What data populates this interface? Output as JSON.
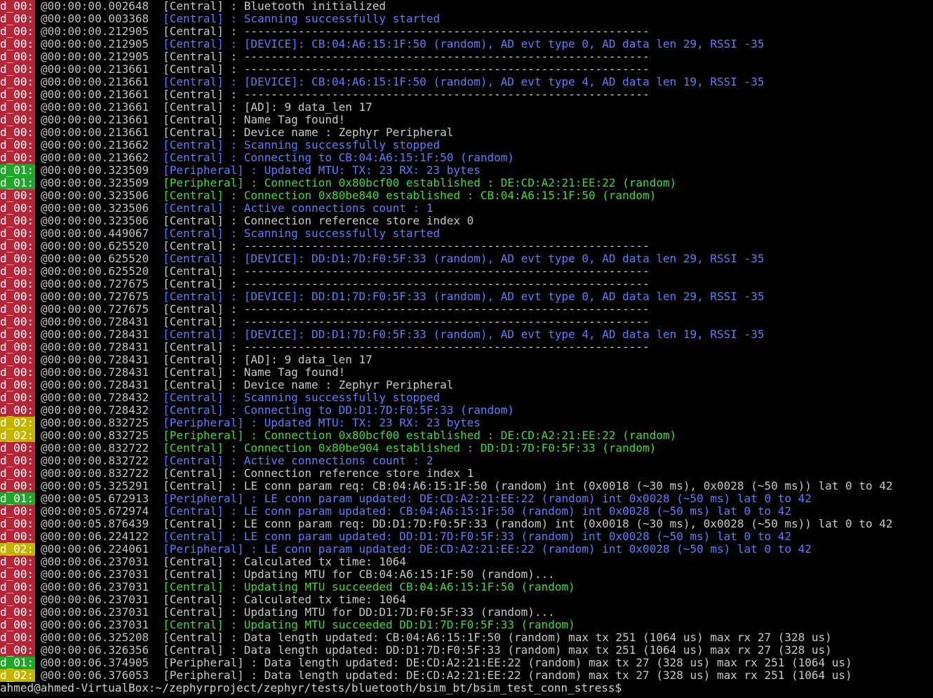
{
  "prompt": "ahmed@ahmed-VirtualBox:~/zephyrproject/zephyr/tests/bluetooth/bsim_bt/bsim_test_conn_stress$",
  "colors": {
    "d_00": "#b3263a",
    "d_01": "#22a52b",
    "d_02": "#c3b400",
    "white": "#c8c8c8",
    "blue": "#5c7cff",
    "green": "#3adb3a"
  },
  "lines": [
    {
      "tag": "d_00:",
      "time": "@00:00:00.002648",
      "role": "[Central]",
      "msg": " : Bluetooth initialized",
      "c": "w"
    },
    {
      "tag": "d_00:",
      "time": "@00:00:00.003368",
      "role": "[Central]",
      "msg": " : Scanning successfully started",
      "c": "b"
    },
    {
      "tag": "d_00:",
      "time": "@00:00:00.212905",
      "role": "[Central]",
      "msg": " : ------------------------------------------------------------",
      "c": "w"
    },
    {
      "tag": "d_00:",
      "time": "@00:00:00.212905",
      "role": "[Central]",
      "msg": " : [DEVICE]: CB:04:A6:15:1F:50 (random), AD evt type 0, AD data len 29, RSSI -35",
      "c": "b"
    },
    {
      "tag": "d_00:",
      "time": "@00:00:00.212905",
      "role": "[Central]",
      "msg": " : ------------------------------------------------------------",
      "c": "w"
    },
    {
      "tag": "d_00:",
      "time": "@00:00:00.213661",
      "role": "[Central]",
      "msg": " : ------------------------------------------------------------",
      "c": "w"
    },
    {
      "tag": "d_00:",
      "time": "@00:00:00.213661",
      "role": "[Central]",
      "msg": " : [DEVICE]: CB:04:A6:15:1F:50 (random), AD evt type 4, AD data len 19, RSSI -35",
      "c": "b"
    },
    {
      "tag": "d_00:",
      "time": "@00:00:00.213661",
      "role": "[Central]",
      "msg": " : ------------------------------------------------------------",
      "c": "w"
    },
    {
      "tag": "d_00:",
      "time": "@00:00:00.213661",
      "role": "[Central]",
      "msg": " : [AD]: 9 data_len 17",
      "c": "w"
    },
    {
      "tag": "d_00:",
      "time": "@00:00:00.213661",
      "role": "[Central]",
      "msg": " : Name Tag found!",
      "c": "w"
    },
    {
      "tag": "d_00:",
      "time": "@00:00:00.213661",
      "role": "[Central]",
      "msg": " : Device name : Zephyr Peripheral",
      "c": "w"
    },
    {
      "tag": "d_00:",
      "time": "@00:00:00.213662",
      "role": "[Central]",
      "msg": " : Scanning successfully stopped",
      "c": "b"
    },
    {
      "tag": "d_00:",
      "time": "@00:00:00.213662",
      "role": "[Central]",
      "msg": " : Connecting to CB:04:A6:15:1F:50 (random)",
      "c": "b"
    },
    {
      "tag": "d_01:",
      "time": "@00:00:00.323509",
      "role": "[Peripheral]",
      "msg": " : Updated MTU: TX: 23 RX: 23 bytes",
      "c": "b"
    },
    {
      "tag": "d_01:",
      "time": "@00:00:00.323509",
      "role": "[Peripheral]",
      "msg": " : Connection 0x80bcf00 established : DE:CD:A2:21:EE:22 (random)",
      "c": "g"
    },
    {
      "tag": "d_00:",
      "time": "@00:00:00.323506",
      "role": "[Central]",
      "msg": " : Connection 0x80be840 established : CB:04:A6:15:1F:50 (random)",
      "c": "g"
    },
    {
      "tag": "d_00:",
      "time": "@00:00:00.323506",
      "role": "[Central]",
      "msg": " : Active connections count : 1",
      "c": "b"
    },
    {
      "tag": "d_00:",
      "time": "@00:00:00.323506",
      "role": "[Central]",
      "msg": " : Connection reference store index 0",
      "c": "w"
    },
    {
      "tag": "d_00:",
      "time": "@00:00:00.449067",
      "role": "[Central]",
      "msg": " : Scanning successfully started",
      "c": "b"
    },
    {
      "tag": "d_00:",
      "time": "@00:00:00.625520",
      "role": "[Central]",
      "msg": " : ------------------------------------------------------------",
      "c": "w"
    },
    {
      "tag": "d_00:",
      "time": "@00:00:00.625520",
      "role": "[Central]",
      "msg": " : [DEVICE]: DD:D1:7D:F0:5F:33 (random), AD evt type 0, AD data len 29, RSSI -35",
      "c": "b"
    },
    {
      "tag": "d_00:",
      "time": "@00:00:00.625520",
      "role": "[Central]",
      "msg": " : ------------------------------------------------------------",
      "c": "w"
    },
    {
      "tag": "d_00:",
      "time": "@00:00:00.727675",
      "role": "[Central]",
      "msg": " : ------------------------------------------------------------",
      "c": "w"
    },
    {
      "tag": "d_00:",
      "time": "@00:00:00.727675",
      "role": "[Central]",
      "msg": " : [DEVICE]: DD:D1:7D:F0:5F:33 (random), AD evt type 0, AD data len 29, RSSI -35",
      "c": "b"
    },
    {
      "tag": "d_00:",
      "time": "@00:00:00.727675",
      "role": "[Central]",
      "msg": " : ------------------------------------------------------------",
      "c": "w"
    },
    {
      "tag": "d_00:",
      "time": "@00:00:00.728431",
      "role": "[Central]",
      "msg": " : ------------------------------------------------------------",
      "c": "w"
    },
    {
      "tag": "d_00:",
      "time": "@00:00:00.728431",
      "role": "[Central]",
      "msg": " : [DEVICE]: DD:D1:7D:F0:5F:33 (random), AD evt type 4, AD data len 19, RSSI -35",
      "c": "b"
    },
    {
      "tag": "d_00:",
      "time": "@00:00:00.728431",
      "role": "[Central]",
      "msg": " : ------------------------------------------------------------",
      "c": "w"
    },
    {
      "tag": "d_00:",
      "time": "@00:00:00.728431",
      "role": "[Central]",
      "msg": " : [AD]: 9 data_len 17",
      "c": "w"
    },
    {
      "tag": "d_00:",
      "time": "@00:00:00.728431",
      "role": "[Central]",
      "msg": " : Name Tag found!",
      "c": "w"
    },
    {
      "tag": "d_00:",
      "time": "@00:00:00.728431",
      "role": "[Central]",
      "msg": " : Device name : Zephyr Peripheral",
      "c": "w"
    },
    {
      "tag": "d_00:",
      "time": "@00:00:00.728432",
      "role": "[Central]",
      "msg": " : Scanning successfully stopped",
      "c": "b"
    },
    {
      "tag": "d_00:",
      "time": "@00:00:00.728432",
      "role": "[Central]",
      "msg": " : Connecting to DD:D1:7D:F0:5F:33 (random)",
      "c": "b"
    },
    {
      "tag": "d_02:",
      "time": "@00:00:00.832725",
      "role": "[Peripheral]",
      "msg": " : Updated MTU: TX: 23 RX: 23 bytes",
      "c": "b"
    },
    {
      "tag": "d_02:",
      "time": "@00:00:00.832725",
      "role": "[Peripheral]",
      "msg": " : Connection 0x80bcf00 established : DE:CD:A2:21:EE:22 (random)",
      "c": "g"
    },
    {
      "tag": "d_00:",
      "time": "@00:00:00.832722",
      "role": "[Central]",
      "msg": " : Connection 0x80be904 established : DD:D1:7D:F0:5F:33 (random)",
      "c": "g"
    },
    {
      "tag": "d_00:",
      "time": "@00:00:00.832722",
      "role": "[Central]",
      "msg": " : Active connections count : 2",
      "c": "b"
    },
    {
      "tag": "d_00:",
      "time": "@00:00:00.832722",
      "role": "[Central]",
      "msg": " : Connection reference store index 1",
      "c": "w"
    },
    {
      "tag": "d_00:",
      "time": "@00:00:05.325291",
      "role": "[Central]",
      "msg": " : LE conn param req: CB:04:A6:15:1F:50 (random) int (0x0018 (~30 ms), 0x0028 (~50 ms)) lat 0 to 42",
      "c": "w"
    },
    {
      "tag": "d_01:",
      "time": "@00:00:05.672913",
      "role": "[Peripheral]",
      "msg": " : LE conn param updated: DE:CD:A2:21:EE:22 (random) int 0x0028 (~50 ms) lat 0 to 42",
      "c": "b"
    },
    {
      "tag": "d_00:",
      "time": "@00:00:05.672974",
      "role": "[Central]",
      "msg": " : LE conn param updated: CB:04:A6:15:1F:50 (random) int 0x0028 (~50 ms) lat 0 to 42",
      "c": "b"
    },
    {
      "tag": "d_00:",
      "time": "@00:00:05.876439",
      "role": "[Central]",
      "msg": " : LE conn param req: DD:D1:7D:F0:5F:33 (random) int (0x0018 (~30 ms), 0x0028 (~50 ms)) lat 0 to 42",
      "c": "w"
    },
    {
      "tag": "d_00:",
      "time": "@00:00:06.224122",
      "role": "[Central]",
      "msg": " : LE conn param updated: DD:D1:7D:F0:5F:33 (random) int 0x0028 (~50 ms) lat 0 to 42",
      "c": "b"
    },
    {
      "tag": "d_02:",
      "time": "@00:00:06.224061",
      "role": "[Peripheral]",
      "msg": " : LE conn param updated: DE:CD:A2:21:EE:22 (random) int 0x0028 (~50 ms) lat 0 to 42",
      "c": "b"
    },
    {
      "tag": "d_00:",
      "time": "@00:00:06.237031",
      "role": "[Central]",
      "msg": " : Calculated tx time: 1064",
      "c": "w"
    },
    {
      "tag": "d_00:",
      "time": "@00:00:06.237031",
      "role": "[Central]",
      "msg": " : Updating MTU for CB:04:A6:15:1F:50 (random)...",
      "c": "w"
    },
    {
      "tag": "d_00:",
      "time": "@00:00:06.237031",
      "role": "[Central]",
      "msg": " : Updating MTU succeeded CB:04:A6:15:1F:50 (random)",
      "c": "g"
    },
    {
      "tag": "d_00:",
      "time": "@00:00:06.237031",
      "role": "[Central]",
      "msg": " : Calculated tx time: 1064",
      "c": "w"
    },
    {
      "tag": "d_00:",
      "time": "@00:00:06.237031",
      "role": "[Central]",
      "msg": " : Updating MTU for DD:D1:7D:F0:5F:33 (random)...",
      "c": "w"
    },
    {
      "tag": "d_00:",
      "time": "@00:00:06.237031",
      "role": "[Central]",
      "msg": " : Updating MTU succeeded DD:D1:7D:F0:5F:33 (random)",
      "c": "g"
    },
    {
      "tag": "d_00:",
      "time": "@00:00:06.325208",
      "role": "[Central]",
      "msg": " : Data length updated: CB:04:A6:15:1F:50 (random) max tx 251 (1064 us) max rx 27 (328 us)",
      "c": "w"
    },
    {
      "tag": "d_00:",
      "time": "@00:00:06.326356",
      "role": "[Central]",
      "msg": " : Data length updated: DD:D1:7D:F0:5F:33 (random) max tx 251 (1064 us) max rx 27 (328 us)",
      "c": "w"
    },
    {
      "tag": "d_01:",
      "time": "@00:00:06.374905",
      "role": "[Peripheral]",
      "msg": " : Data length updated: DE:CD:A2:21:EE:22 (random) max tx 27 (328 us) max rx 251 (1064 us)",
      "c": "w"
    },
    {
      "tag": "d_02:",
      "time": "@00:00:06.376053",
      "role": "[Peripheral]",
      "msg": " : Data length updated: DE:CD:A2:21:EE:22 (random) max tx 27 (328 us) max rx 251 (1064 us)",
      "c": "w"
    }
  ]
}
